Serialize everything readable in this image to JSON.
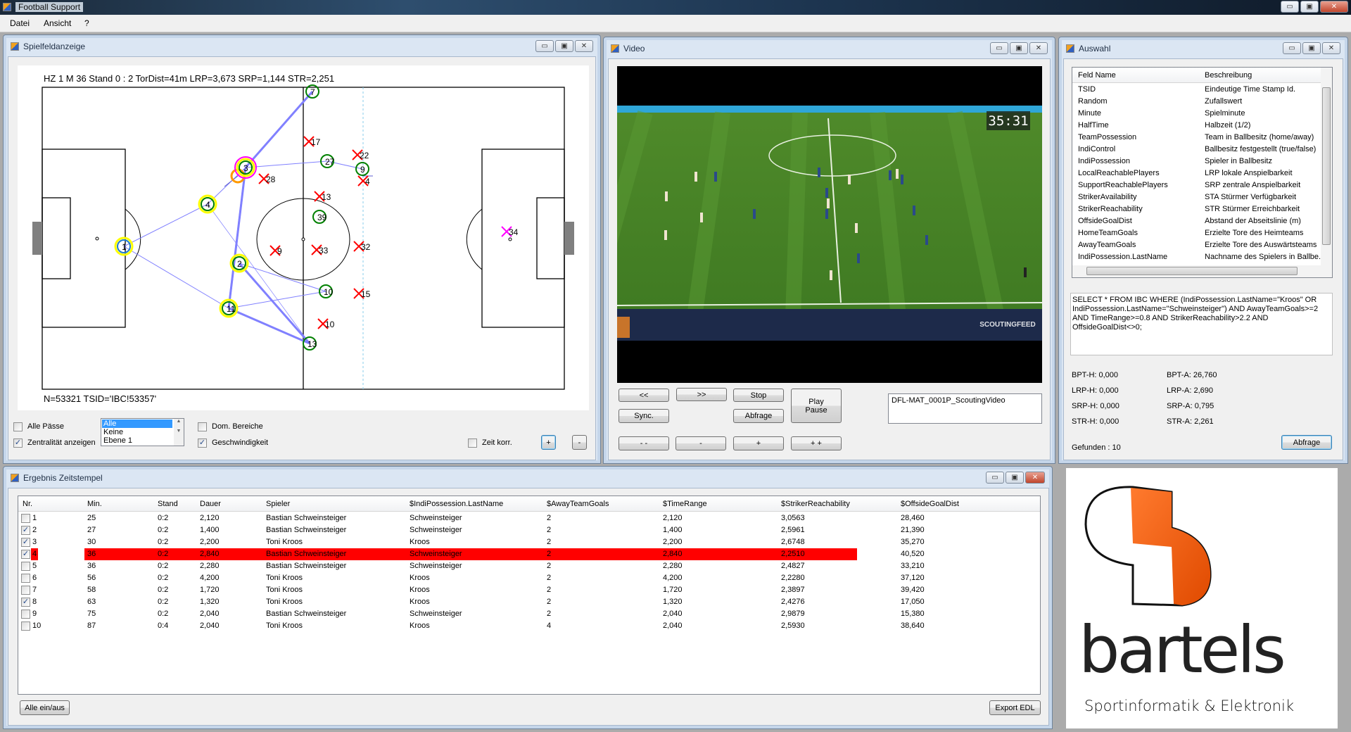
{
  "app": {
    "title": "Football Support"
  },
  "menu": [
    "Datei",
    "Ansicht",
    "?"
  ],
  "window_buttons": {
    "minimize": "▭",
    "maximize": "▣",
    "close": "✕"
  },
  "field_window": {
    "title": "Spielfeldanzeige",
    "header_text": "HZ 1 M 36 Stand 0 : 2 TorDist=41m LRP=3,673 SRP=1,144 STR=2,251",
    "footer_text": "N=53321 TSID='IBC!53357'",
    "players": [
      {
        "label": "1",
        "team": "home",
        "marker": "circle",
        "color": "#1f7bd0",
        "ring": "#ffff00"
      },
      {
        "label": "4",
        "team": "home",
        "marker": "circle",
        "color": "#008000",
        "ring": "#ffff00"
      },
      {
        "label": "3",
        "team": "home",
        "marker": "circle",
        "color": "#008000",
        "ring": "#ffff00",
        "highlight": "#ff00ff"
      },
      {
        "label": "2",
        "team": "home",
        "marker": "circle",
        "color": "#008000",
        "ring": "#ffff00"
      },
      {
        "label": "11",
        "team": "home",
        "marker": "circle",
        "color": "#008000",
        "ring": "#ffff00"
      },
      {
        "label": "7",
        "team": "home",
        "marker": "circle",
        "color": "#008000"
      },
      {
        "label": "27",
        "team": "home",
        "marker": "circle",
        "color": "#008000"
      },
      {
        "label": "9",
        "team": "home",
        "marker": "circle",
        "color": "#008000"
      },
      {
        "label": "39",
        "team": "home",
        "marker": "circle",
        "color": "#008000"
      },
      {
        "label": "10",
        "team": "home",
        "marker": "circle",
        "color": "#008000"
      },
      {
        "label": "13",
        "team": "home",
        "marker": "circle",
        "color": "#008000"
      },
      {
        "label": "17",
        "team": "away",
        "marker": "cross",
        "color": "#ff0000"
      },
      {
        "label": "22",
        "team": "away",
        "marker": "cross",
        "color": "#ff0000"
      },
      {
        "label": "4",
        "team": "away",
        "marker": "cross",
        "color": "#ff0000"
      },
      {
        "label": "28",
        "team": "away",
        "marker": "cross",
        "color": "#ff0000"
      },
      {
        "label": "13",
        "team": "away",
        "marker": "cross",
        "color": "#ff0000"
      },
      {
        "label": "9",
        "team": "away",
        "marker": "cross",
        "color": "#ff0000"
      },
      {
        "label": "33",
        "team": "away",
        "marker": "cross",
        "color": "#ff0000"
      },
      {
        "label": "32",
        "team": "away",
        "marker": "cross",
        "color": "#ff0000"
      },
      {
        "label": "15",
        "team": "away",
        "marker": "cross",
        "color": "#ff0000"
      },
      {
        "label": "10",
        "team": "away",
        "marker": "cross",
        "color": "#ff0000"
      },
      {
        "label": "34",
        "team": "away",
        "marker": "cross",
        "color": "#ff00ff"
      }
    ],
    "pass_color": "#8080ff",
    "ball_color": "#ff9900",
    "offside_line_color": "#87ceeb",
    "controls": {
      "all_passes": {
        "label": "Alle Pässe",
        "checked": false
      },
      "show_centrality": {
        "label": "Zentralität anzeigen",
        "checked": true
      },
      "level_list": {
        "options": [
          "Alle",
          "Keine",
          "Ebene 1"
        ],
        "selected": "Alle"
      },
      "dominant_areas": {
        "label": "Dom. Bereiche",
        "checked": false
      },
      "speed": {
        "label": "Geschwindigkeit",
        "checked": true
      },
      "time_corr": {
        "label": "Zeit korr.",
        "checked": false
      },
      "plus": "+",
      "minus": "-"
    }
  },
  "video_window": {
    "title": "Video",
    "clock": "35:31",
    "watermark": "SCOUTINGFEED",
    "buttons": {
      "rewind": "<<",
      "forward": ">>",
      "stop": "Stop",
      "play_pause_1": "Play",
      "play_pause_2": "Pause",
      "sync": "Sync.",
      "query": "Abfrage",
      "minus2": "- -",
      "minus": "-",
      "plus": "+",
      "plus2": "+ +"
    },
    "file": "DFL-MAT_0001P_ScoutingVideo"
  },
  "selection_window": {
    "title": "Auswahl",
    "columns": [
      "Feld Name",
      "Beschreibung"
    ],
    "fields": [
      [
        "TSID",
        "Eindeutige Time Stamp Id."
      ],
      [
        "Random",
        "Zufallswert"
      ],
      [
        "Minute",
        "Spielminute"
      ],
      [
        "HalfTime",
        "Halbzeit (1/2)"
      ],
      [
        "TeamPossession",
        "Team in Ballbesitz (home/away)"
      ],
      [
        "IndiControl",
        "Ballbesitz festgestellt (true/false)"
      ],
      [
        "IndiPossession",
        "Spieler in Ballbesitz"
      ],
      [
        "LocalReachablePlayers",
        "LRP lokale Anspielbarkeit"
      ],
      [
        "SupportReachablePlayers",
        "SRP zentrale Anspielbarkeit"
      ],
      [
        "StrikerAvailability",
        "STA Stürmer Verfügbarkeit"
      ],
      [
        "StrikerReachability",
        "STR Stürmer Erreichbarkeit"
      ],
      [
        "OffsideGoalDist",
        "Abstand der Abseitslinie (m)"
      ],
      [
        "HomeTeamGoals",
        "Erzielte Tore des Heimteams"
      ],
      [
        "AwayTeamGoals",
        "Erzielte Tore des Auswärtsteams"
      ],
      [
        "IndiPossession.LastName",
        "Nachname des Spielers in Ballbe..."
      ]
    ],
    "query": "SELECT * FROM IBC WHERE (IndiPossession.LastName=\"Kroos\" OR IndiPossession.LastName=\"Schweinsteiger\") AND AwayTeamGoals>=2 AND TimeRange>=0.8 AND StrikerReachability>2.2 AND OffsideGoalDist<>0;",
    "stats_home": [
      "BPT-H: 0,000",
      "LRP-H: 0,000",
      "SRP-H: 0,000",
      "STR-H: 0,000"
    ],
    "stats_away": [
      "BPT-A: 26,760",
      "LRP-A: 2,690",
      "SRP-A: 0,795",
      "STR-A: 2,261"
    ],
    "found": "Gefunden : 10",
    "query_button": "Abfrage"
  },
  "results_window": {
    "title": "Ergebnis Zeitstempel",
    "columns": [
      "Nr.",
      "Min.",
      "Stand",
      "Dauer",
      "Spieler",
      "$IndiPossession.LastName",
      "$AwayTeamGoals",
      "$TimeRange",
      "$StrikerReachability",
      "$OffsideGoalDist"
    ],
    "rows": [
      {
        "checked": false,
        "cells": [
          "1",
          "25",
          "0:2",
          "2,120",
          "Bastian Schweinsteiger",
          "Schweinsteiger",
          "2",
          "2,120",
          "3,0563",
          "28,460"
        ]
      },
      {
        "checked": true,
        "cells": [
          "2",
          "27",
          "0:2",
          "1,400",
          "Bastian Schweinsteiger",
          "Schweinsteiger",
          "2",
          "1,400",
          "2,5961",
          "21,390"
        ]
      },
      {
        "checked": true,
        "cells": [
          "3",
          "30",
          "0:2",
          "2,200",
          "Toni Kroos",
          "Kroos",
          "2",
          "2,200",
          "2,6748",
          "35,270"
        ]
      },
      {
        "checked": true,
        "selected": true,
        "cells": [
          "4",
          "36",
          "0:2",
          "2,840",
          "Bastian Schweinsteiger",
          "Schweinsteiger",
          "2",
          "2,840",
          "2,2510",
          "40,520"
        ]
      },
      {
        "checked": false,
        "cells": [
          "5",
          "36",
          "0:2",
          "2,280",
          "Bastian Schweinsteiger",
          "Schweinsteiger",
          "2",
          "2,280",
          "2,4827",
          "33,210"
        ]
      },
      {
        "checked": false,
        "cells": [
          "6",
          "56",
          "0:2",
          "4,200",
          "Toni Kroos",
          "Kroos",
          "2",
          "4,200",
          "2,2280",
          "37,120"
        ]
      },
      {
        "checked": false,
        "cells": [
          "7",
          "58",
          "0:2",
          "1,720",
          "Toni Kroos",
          "Kroos",
          "2",
          "1,720",
          "2,3897",
          "39,420"
        ]
      },
      {
        "checked": true,
        "cells": [
          "8",
          "63",
          "0:2",
          "1,320",
          "Toni Kroos",
          "Kroos",
          "2",
          "1,320",
          "2,4276",
          "17,050"
        ]
      },
      {
        "checked": false,
        "cells": [
          "9",
          "75",
          "0:2",
          "2,040",
          "Bastian Schweinsteiger",
          "Schweinsteiger",
          "2",
          "2,040",
          "2,9879",
          "15,380"
        ]
      },
      {
        "checked": false,
        "cells": [
          "10",
          "87",
          "0:4",
          "2,040",
          "Toni Kroos",
          "Kroos",
          "4",
          "2,040",
          "2,5930",
          "38,640"
        ]
      }
    ],
    "selected_color": "#ff0000",
    "toggle_all": "Alle ein/aus",
    "export": "Export EDL"
  },
  "logo": {
    "name": "bartels",
    "tagline": "Sportinformatik & Elektronik",
    "accent": "#f26a1b"
  }
}
